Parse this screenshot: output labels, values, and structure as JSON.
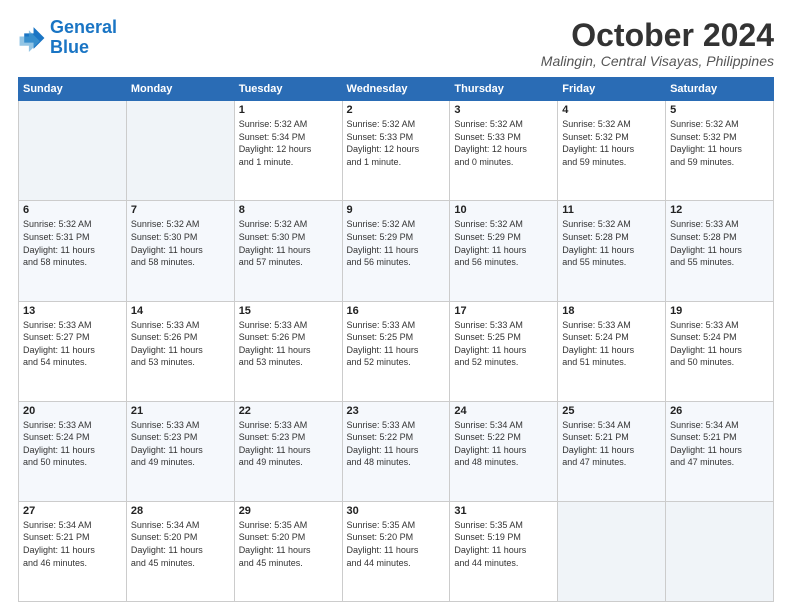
{
  "logo": {
    "line1": "General",
    "line2": "Blue"
  },
  "title": "October 2024",
  "subtitle": "Malingin, Central Visayas, Philippines",
  "days_of_week": [
    "Sunday",
    "Monday",
    "Tuesday",
    "Wednesday",
    "Thursday",
    "Friday",
    "Saturday"
  ],
  "weeks": [
    [
      {
        "day": "",
        "detail": ""
      },
      {
        "day": "",
        "detail": ""
      },
      {
        "day": "1",
        "detail": "Sunrise: 5:32 AM\nSunset: 5:34 PM\nDaylight: 12 hours\nand 1 minute."
      },
      {
        "day": "2",
        "detail": "Sunrise: 5:32 AM\nSunset: 5:33 PM\nDaylight: 12 hours\nand 1 minute."
      },
      {
        "day": "3",
        "detail": "Sunrise: 5:32 AM\nSunset: 5:33 PM\nDaylight: 12 hours\nand 0 minutes."
      },
      {
        "day": "4",
        "detail": "Sunrise: 5:32 AM\nSunset: 5:32 PM\nDaylight: 11 hours\nand 59 minutes."
      },
      {
        "day": "5",
        "detail": "Sunrise: 5:32 AM\nSunset: 5:32 PM\nDaylight: 11 hours\nand 59 minutes."
      }
    ],
    [
      {
        "day": "6",
        "detail": "Sunrise: 5:32 AM\nSunset: 5:31 PM\nDaylight: 11 hours\nand 58 minutes."
      },
      {
        "day": "7",
        "detail": "Sunrise: 5:32 AM\nSunset: 5:30 PM\nDaylight: 11 hours\nand 58 minutes."
      },
      {
        "day": "8",
        "detail": "Sunrise: 5:32 AM\nSunset: 5:30 PM\nDaylight: 11 hours\nand 57 minutes."
      },
      {
        "day": "9",
        "detail": "Sunrise: 5:32 AM\nSunset: 5:29 PM\nDaylight: 11 hours\nand 56 minutes."
      },
      {
        "day": "10",
        "detail": "Sunrise: 5:32 AM\nSunset: 5:29 PM\nDaylight: 11 hours\nand 56 minutes."
      },
      {
        "day": "11",
        "detail": "Sunrise: 5:32 AM\nSunset: 5:28 PM\nDaylight: 11 hours\nand 55 minutes."
      },
      {
        "day": "12",
        "detail": "Sunrise: 5:33 AM\nSunset: 5:28 PM\nDaylight: 11 hours\nand 55 minutes."
      }
    ],
    [
      {
        "day": "13",
        "detail": "Sunrise: 5:33 AM\nSunset: 5:27 PM\nDaylight: 11 hours\nand 54 minutes."
      },
      {
        "day": "14",
        "detail": "Sunrise: 5:33 AM\nSunset: 5:26 PM\nDaylight: 11 hours\nand 53 minutes."
      },
      {
        "day": "15",
        "detail": "Sunrise: 5:33 AM\nSunset: 5:26 PM\nDaylight: 11 hours\nand 53 minutes."
      },
      {
        "day": "16",
        "detail": "Sunrise: 5:33 AM\nSunset: 5:25 PM\nDaylight: 11 hours\nand 52 minutes."
      },
      {
        "day": "17",
        "detail": "Sunrise: 5:33 AM\nSunset: 5:25 PM\nDaylight: 11 hours\nand 52 minutes."
      },
      {
        "day": "18",
        "detail": "Sunrise: 5:33 AM\nSunset: 5:24 PM\nDaylight: 11 hours\nand 51 minutes."
      },
      {
        "day": "19",
        "detail": "Sunrise: 5:33 AM\nSunset: 5:24 PM\nDaylight: 11 hours\nand 50 minutes."
      }
    ],
    [
      {
        "day": "20",
        "detail": "Sunrise: 5:33 AM\nSunset: 5:24 PM\nDaylight: 11 hours\nand 50 minutes."
      },
      {
        "day": "21",
        "detail": "Sunrise: 5:33 AM\nSunset: 5:23 PM\nDaylight: 11 hours\nand 49 minutes."
      },
      {
        "day": "22",
        "detail": "Sunrise: 5:33 AM\nSunset: 5:23 PM\nDaylight: 11 hours\nand 49 minutes."
      },
      {
        "day": "23",
        "detail": "Sunrise: 5:33 AM\nSunset: 5:22 PM\nDaylight: 11 hours\nand 48 minutes."
      },
      {
        "day": "24",
        "detail": "Sunrise: 5:34 AM\nSunset: 5:22 PM\nDaylight: 11 hours\nand 48 minutes."
      },
      {
        "day": "25",
        "detail": "Sunrise: 5:34 AM\nSunset: 5:21 PM\nDaylight: 11 hours\nand 47 minutes."
      },
      {
        "day": "26",
        "detail": "Sunrise: 5:34 AM\nSunset: 5:21 PM\nDaylight: 11 hours\nand 47 minutes."
      }
    ],
    [
      {
        "day": "27",
        "detail": "Sunrise: 5:34 AM\nSunset: 5:21 PM\nDaylight: 11 hours\nand 46 minutes."
      },
      {
        "day": "28",
        "detail": "Sunrise: 5:34 AM\nSunset: 5:20 PM\nDaylight: 11 hours\nand 45 minutes."
      },
      {
        "day": "29",
        "detail": "Sunrise: 5:35 AM\nSunset: 5:20 PM\nDaylight: 11 hours\nand 45 minutes."
      },
      {
        "day": "30",
        "detail": "Sunrise: 5:35 AM\nSunset: 5:20 PM\nDaylight: 11 hours\nand 44 minutes."
      },
      {
        "day": "31",
        "detail": "Sunrise: 5:35 AM\nSunset: 5:19 PM\nDaylight: 11 hours\nand 44 minutes."
      },
      {
        "day": "",
        "detail": ""
      },
      {
        "day": "",
        "detail": ""
      }
    ]
  ]
}
